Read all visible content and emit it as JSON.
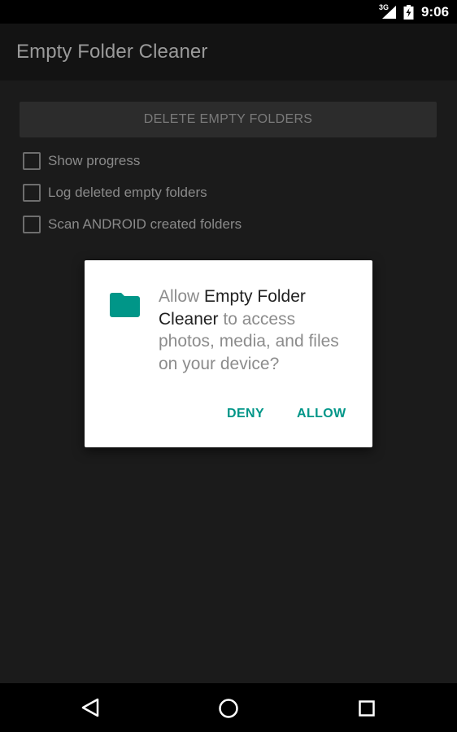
{
  "status_bar": {
    "network": "3G",
    "time": "9:06",
    "icons": [
      "signal-icon",
      "battery-icon"
    ]
  },
  "app": {
    "title": "Empty Folder Cleaner",
    "delete_button_label": "DELETE EMPTY FOLDERS",
    "options": [
      {
        "label": "Show progress",
        "checked": false
      },
      {
        "label": "Log deleted empty folders",
        "checked": false
      },
      {
        "label": "Scan ANDROID created folders",
        "checked": false
      }
    ]
  },
  "dialog": {
    "icon": "folder-icon",
    "message_prefix": "Allow ",
    "app_name": "Empty Folder Cleaner",
    "message_suffix": " to access photos, media, and files on your device?",
    "deny_label": "DENY",
    "allow_label": "ALLOW"
  },
  "colors": {
    "accent": "#009688",
    "dialog_text": "#8c8c8c",
    "app_name_text": "#212121",
    "screen_background": "#1b1b1b"
  },
  "nav_bar": {
    "icons": [
      "back-icon",
      "home-icon",
      "recents-icon"
    ]
  }
}
